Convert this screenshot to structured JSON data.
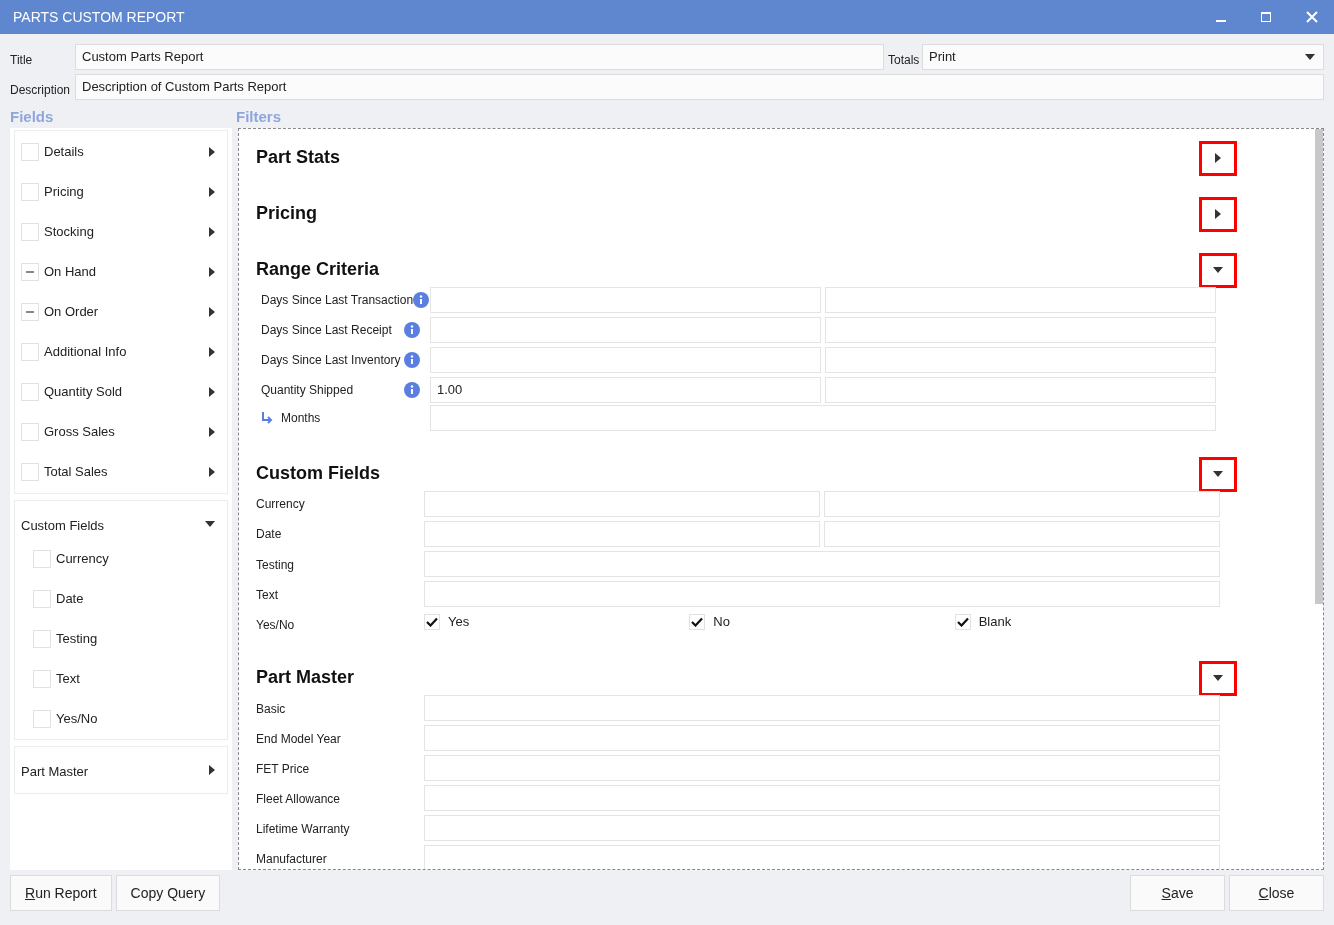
{
  "window": {
    "title": "PARTS CUSTOM REPORT"
  },
  "header": {
    "title_label": "Title",
    "title_value": "Custom Parts Report",
    "totals_label": "Totals",
    "totals_value": "Print",
    "description_label": "Description",
    "description_value": "Description of Custom Parts Report"
  },
  "fields_heading": "Fields",
  "filters_heading": "Filters",
  "fields": [
    {
      "kind": "group",
      "items": [
        {
          "label": "Details",
          "partial": false
        },
        {
          "label": "Pricing",
          "partial": false
        },
        {
          "label": "Stocking",
          "partial": false
        },
        {
          "label": "On Hand",
          "partial": true
        },
        {
          "label": "On Order",
          "partial": true
        },
        {
          "label": "Additional Info",
          "partial": false
        },
        {
          "label": "Quantity Sold",
          "partial": false
        },
        {
          "label": "Gross Sales",
          "partial": false
        },
        {
          "label": "Total Sales",
          "partial": false
        }
      ]
    },
    {
      "kind": "section",
      "label": "Custom Fields",
      "expanded": true,
      "items": [
        {
          "label": "Currency",
          "partial": false
        },
        {
          "label": "Date",
          "partial": false
        },
        {
          "label": "Testing",
          "partial": false
        },
        {
          "label": "Text",
          "partial": false
        },
        {
          "label": "Yes/No",
          "partial": false
        }
      ]
    },
    {
      "kind": "section",
      "label": "Part Master",
      "expanded": false
    }
  ],
  "filters": [
    {
      "title": "Part Stats",
      "expanded": false
    },
    {
      "title": "Pricing",
      "expanded": false
    },
    {
      "title": "Range Criteria",
      "expanded": true,
      "rows": [
        {
          "kind": "range",
          "label": "Days Since Last Transaction",
          "info": true
        },
        {
          "kind": "range",
          "label": "Days Since Last Receipt",
          "info": true
        },
        {
          "kind": "range",
          "label": "Days Since Last Inventory",
          "info": true
        },
        {
          "kind": "range",
          "label": "Quantity Shipped",
          "info": true,
          "value": "1.00"
        },
        {
          "kind": "sub",
          "label": "Months"
        }
      ]
    },
    {
      "title": "Custom Fields",
      "expanded": true,
      "rows": [
        {
          "kind": "range",
          "label": "Currency"
        },
        {
          "kind": "range",
          "label": "Date"
        },
        {
          "kind": "single",
          "label": "Testing"
        },
        {
          "kind": "single",
          "label": "Text"
        },
        {
          "kind": "checks",
          "label": "Yes/No",
          "options": [
            {
              "label": "Yes",
              "checked": true
            },
            {
              "label": "No",
              "checked": true
            },
            {
              "label": "Blank",
              "checked": true
            }
          ]
        }
      ]
    },
    {
      "title": "Part Master",
      "expanded": true,
      "rows": [
        {
          "kind": "single",
          "label": "Basic"
        },
        {
          "kind": "single",
          "label": "End Model Year"
        },
        {
          "kind": "single",
          "label": "FET  Price"
        },
        {
          "kind": "single",
          "label": "Fleet  Allowance"
        },
        {
          "kind": "single",
          "label": "Lifetime Warranty"
        },
        {
          "kind": "single",
          "label": "Manufacturer"
        }
      ]
    }
  ],
  "buttons_left": [
    {
      "mnemonic": "R",
      "rest": "un Report"
    },
    {
      "rest": "Copy Query"
    }
  ],
  "buttons_right": [
    {
      "mnemonic": "S",
      "rest": "ave"
    },
    {
      "mnemonic": "C",
      "rest": "lose"
    }
  ]
}
